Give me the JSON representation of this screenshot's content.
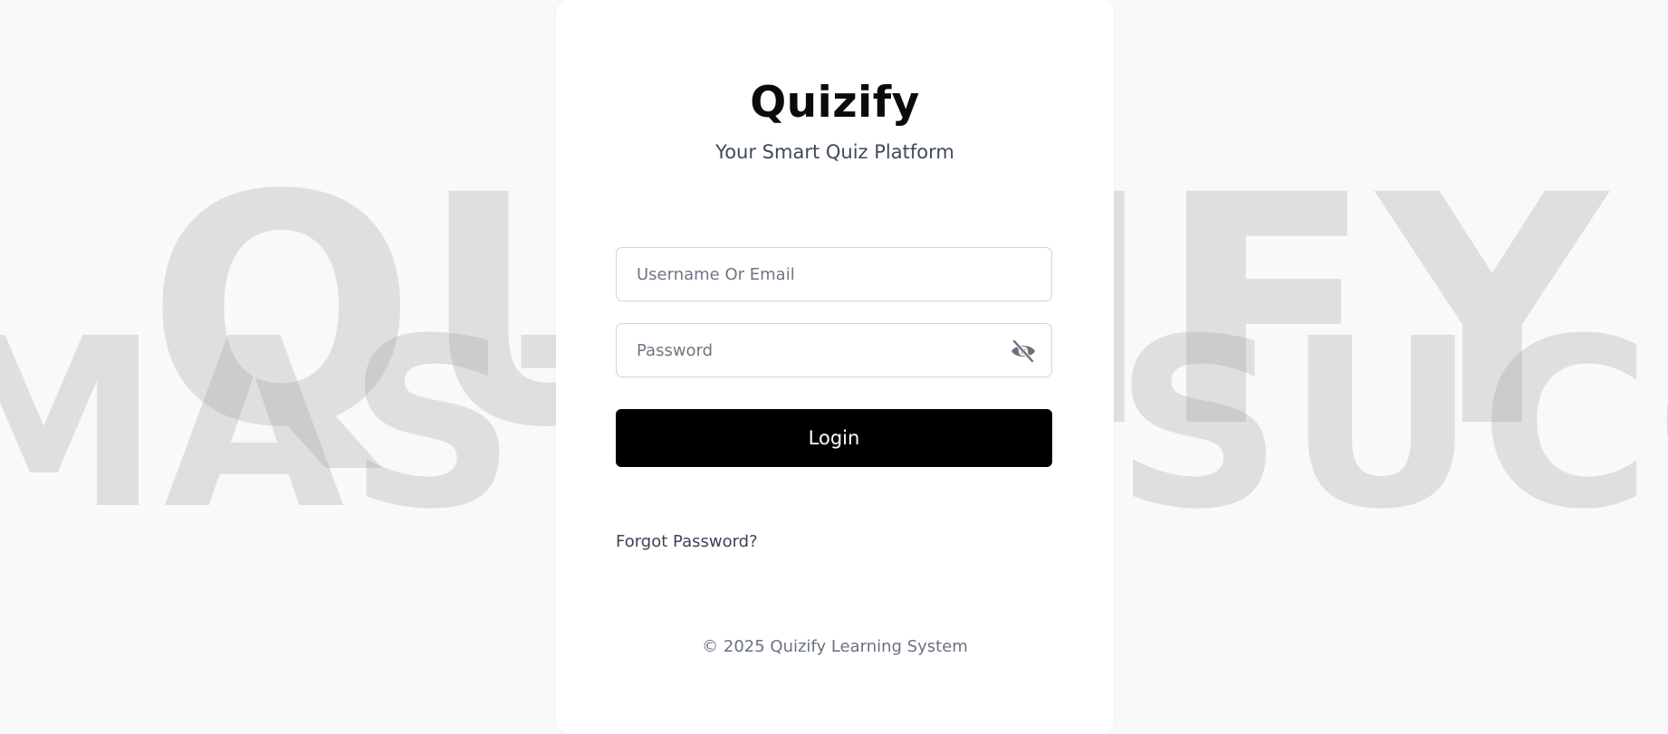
{
  "background": {
    "line1": "QUIZIFY",
    "line2": "MASTER SUCCESS P"
  },
  "brand": {
    "name": "Quizify",
    "tagline": "Your Smart Quiz Platform"
  },
  "form": {
    "username_placeholder": "Username Or Email",
    "password_placeholder": "Password",
    "password_toggle_icon": "eye-slash-icon",
    "login_label": "Login",
    "forgot_label": "Forgot Password?"
  },
  "footer": {
    "copyright": "© 2025 Quizify Learning System"
  },
  "colors": {
    "page_background": "#f8f9fa",
    "card_background": "#ffffff",
    "button_background": "#000000",
    "button_text": "#ffffff",
    "watermark": "#969898"
  }
}
